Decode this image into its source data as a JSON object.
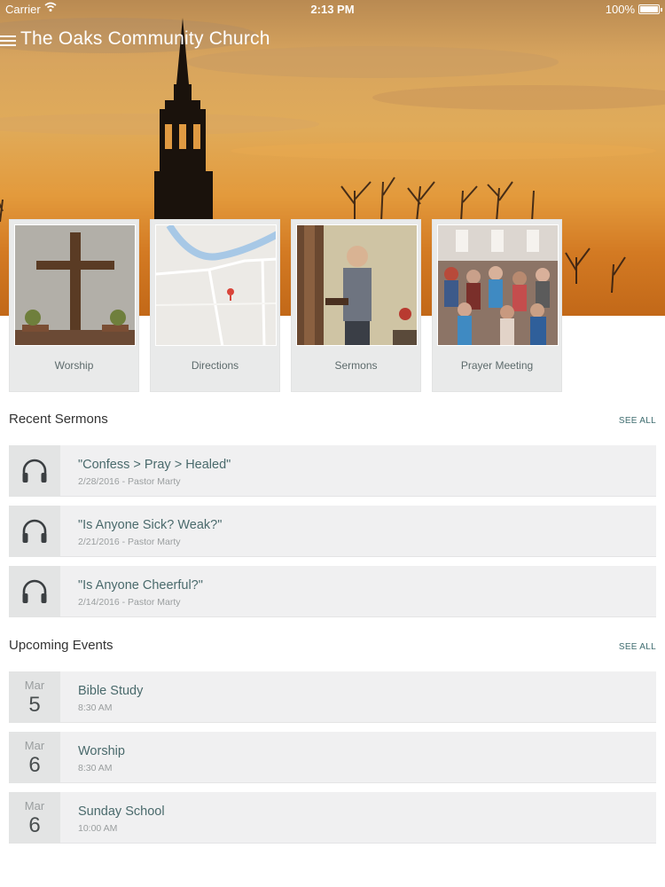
{
  "status_bar": {
    "carrier": "Carrier",
    "time": "2:13 PM",
    "battery": "100%"
  },
  "header": {
    "title": "The Oaks Community Church"
  },
  "tiles": [
    {
      "label": "Worship",
      "image": "cross-image"
    },
    {
      "label": "Directions",
      "image": "map-image"
    },
    {
      "label": "Sermons",
      "image": "preacher-image"
    },
    {
      "label": "Prayer Meeting",
      "image": "congregation-image"
    }
  ],
  "recent_sermons": {
    "title": "Recent Sermons",
    "see_all": "SEE ALL",
    "items": [
      {
        "title": "\"Confess > Pray > Healed\"",
        "meta": "2/28/2016 - Pastor Marty",
        "icon": "headphones-icon"
      },
      {
        "title": "\"Is Anyone Sick? Weak?\"",
        "meta": "2/21/2016 - Pastor Marty",
        "icon": "headphones-icon"
      },
      {
        "title": "\"Is Anyone Cheerful?\"",
        "meta": "2/14/2016 - Pastor Marty",
        "icon": "headphones-icon"
      }
    ]
  },
  "upcoming_events": {
    "title": "Upcoming Events",
    "see_all": "SEE ALL",
    "items": [
      {
        "month": "Mar",
        "day": "5",
        "title": "Bible Study",
        "time": "8:30 AM"
      },
      {
        "month": "Mar",
        "day": "6",
        "title": "Worship",
        "time": "8:30 AM"
      },
      {
        "month": "Mar",
        "day": "6",
        "title": "Sunday School",
        "time": "10:00 AM"
      }
    ]
  },
  "colors": {
    "accent": "#3f6d70",
    "row_bg": "#f0f0f1",
    "sky": "#e0ab5a"
  }
}
